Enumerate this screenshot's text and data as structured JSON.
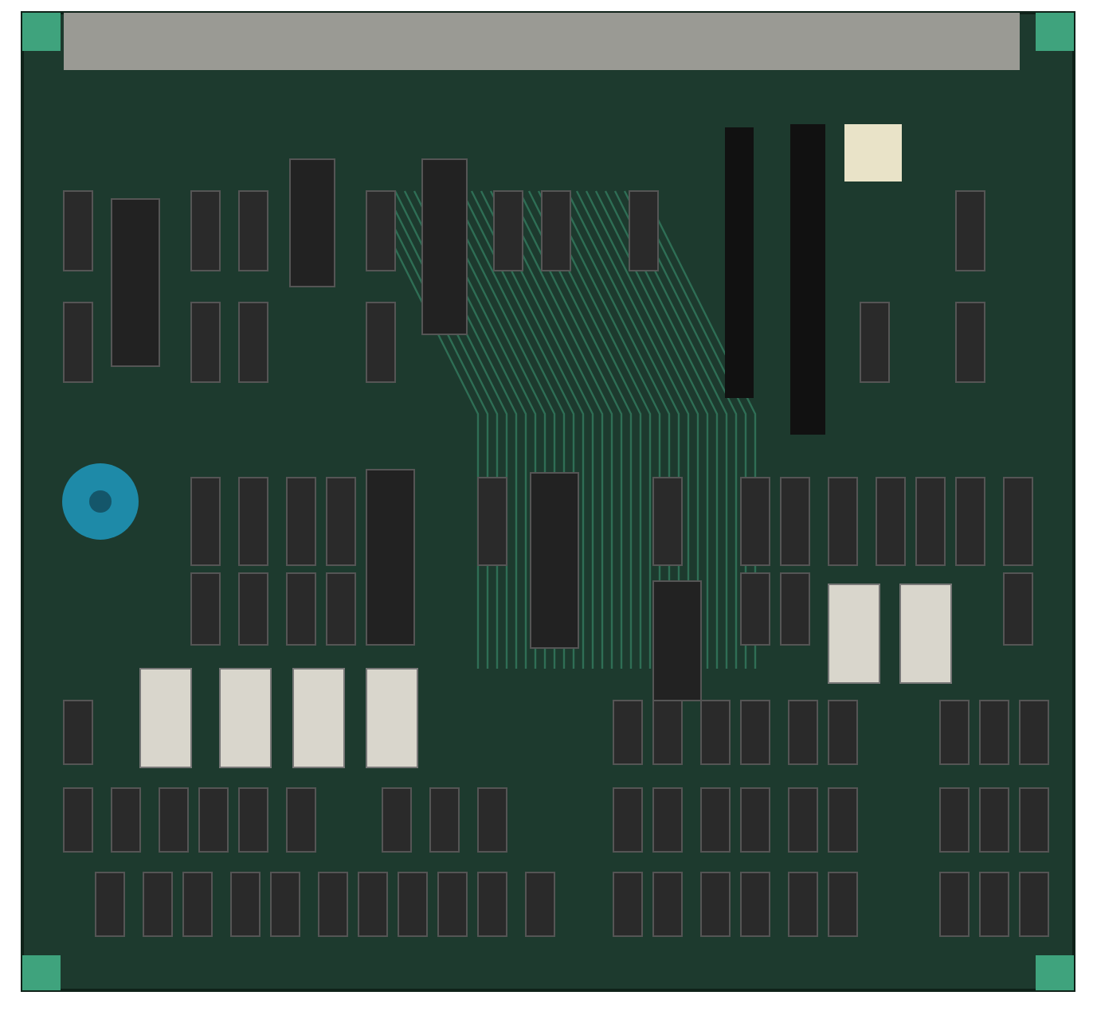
{
  "photo": {
    "kind": "circuit-board"
  }
}
